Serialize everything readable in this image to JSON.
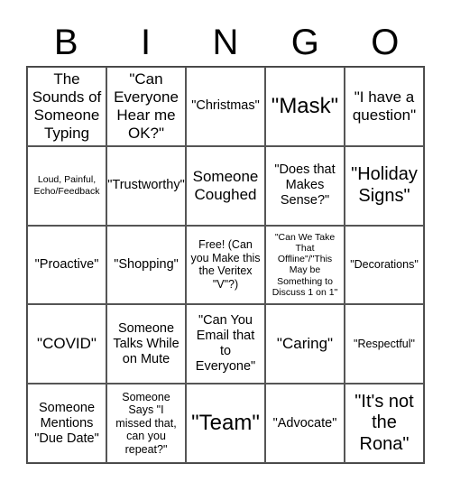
{
  "header": {
    "letters": [
      "B",
      "I",
      "N",
      "G",
      "O"
    ]
  },
  "grid": {
    "rows": [
      [
        "The Sounds of Someone Typing",
        "\"Can Everyone Hear me OK?\"",
        "\"Christmas\"",
        "\"Mask\"",
        "\"I have a question\""
      ],
      [
        "Loud, Painful, Echo/Feedback",
        "\"Trustworthy\"",
        "Someone Coughed",
        "\"Does that Makes Sense?\"",
        "\"Holiday Signs\""
      ],
      [
        "\"Proactive\"",
        "\"Shopping\"",
        "Free! (Can you Make this the Veritex \"V\"?)",
        "\"Can We Take That Offline\"/\"This May be Something to Discuss 1 on 1\"",
        "\"Decorations\""
      ],
      [
        "\"COVID\"",
        "Someone Talks While on Mute",
        "\"Can You Email that to Everyone\"",
        "\"Caring\"",
        "\"Respectful\""
      ],
      [
        "Someone Mentions \"Due Date\"",
        "Someone Says \"I missed that, can you repeat?\"",
        "\"Team\"",
        "\"Advocate\"",
        "\"It's not the Rona\""
      ]
    ]
  }
}
